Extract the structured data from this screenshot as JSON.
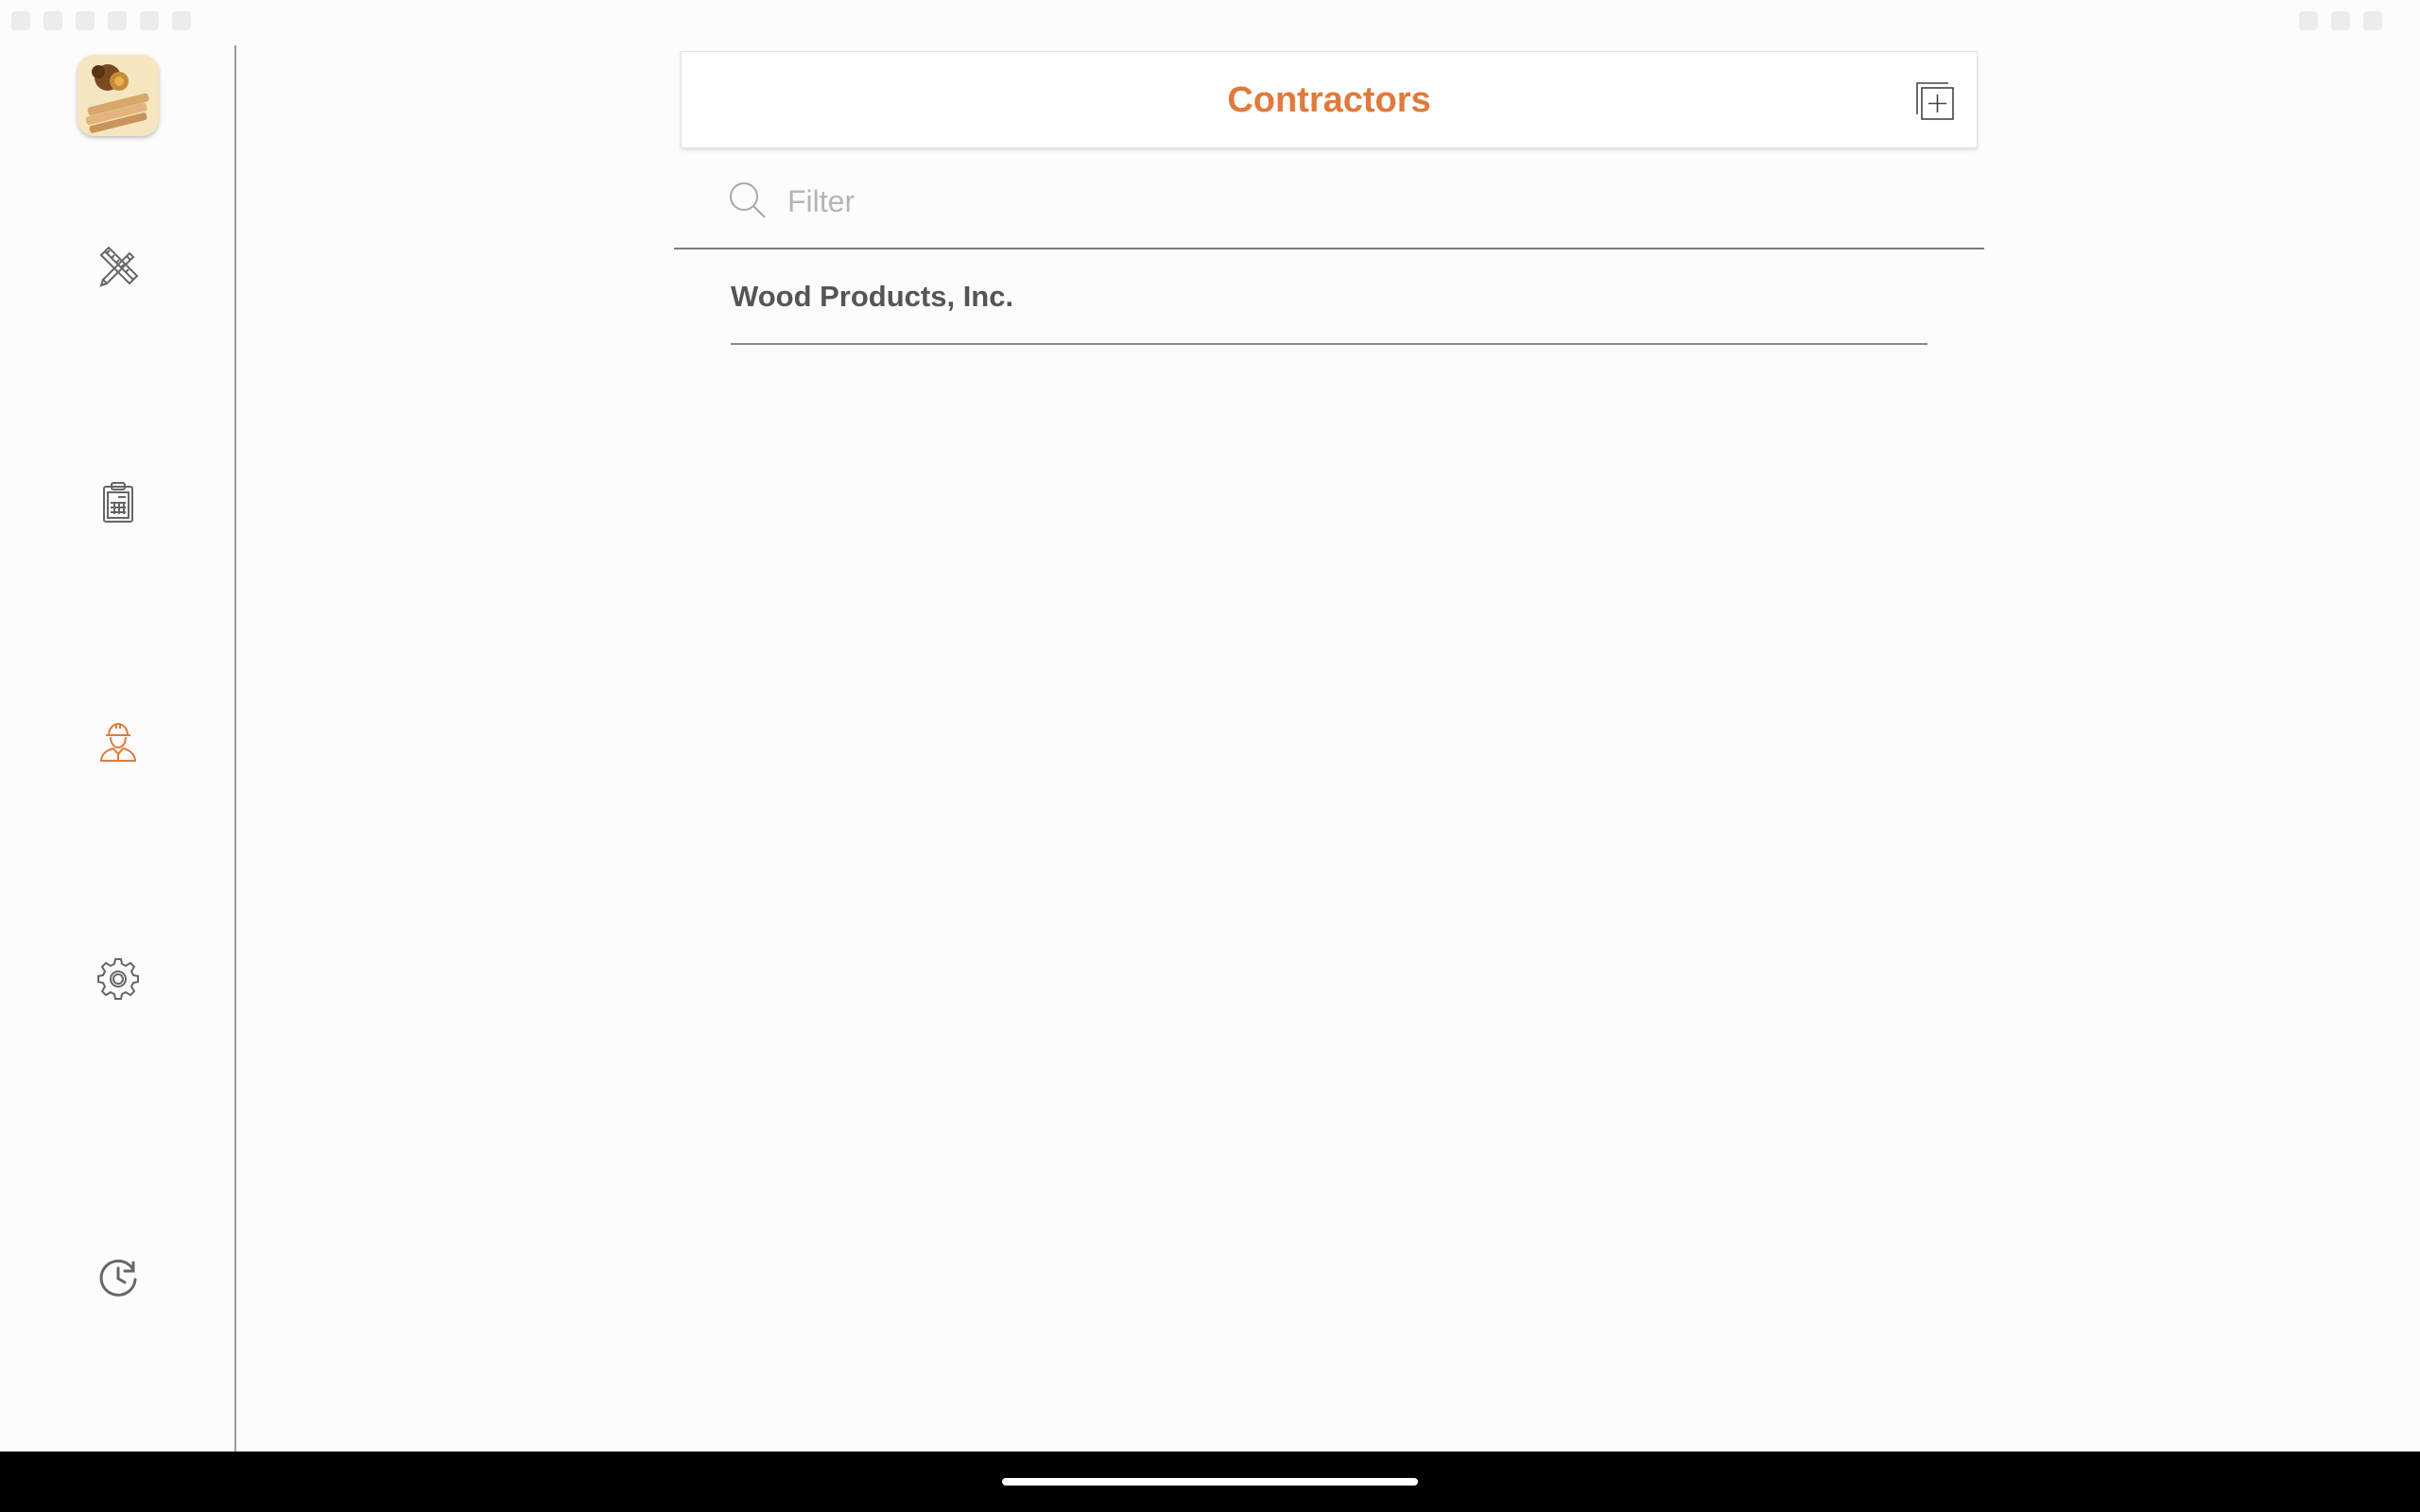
{
  "header": {
    "title": "Contractors",
    "add_icon": "add-item-icon"
  },
  "filter": {
    "placeholder": "Filter",
    "value": "",
    "icon": "search-icon"
  },
  "contractors": [
    {
      "name": "Wood Products, Inc."
    }
  ],
  "sidebar": {
    "logo": "app-logo",
    "items": [
      {
        "icon": "pencil-ruler-icon",
        "active": false
      },
      {
        "icon": "clipboard-icon",
        "active": false
      },
      {
        "icon": "contractor-worker-icon",
        "active": true
      },
      {
        "icon": "gear-icon",
        "active": false
      },
      {
        "icon": "history-clock-icon",
        "active": false
      }
    ]
  },
  "colors": {
    "accent": "#e07a3c",
    "icon_default": "#666666",
    "background": "#fcfcfc",
    "system_bar": "#000000"
  }
}
